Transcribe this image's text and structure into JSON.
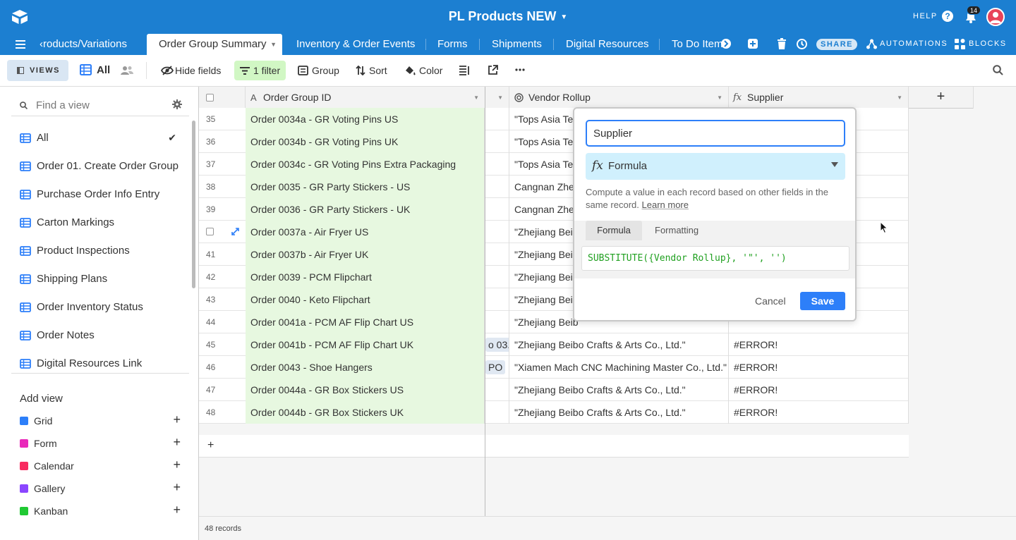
{
  "topbar": {
    "base_title": "PL Products NEW",
    "help_label": "HELP",
    "help_icon_glyph": "?",
    "notification_count": "14",
    "accent_color": "#1c7fd1"
  },
  "tabs": [
    {
      "label": "‹roducts/Variations"
    },
    {
      "label": "Order Group Summary",
      "active": true
    },
    {
      "label": "Inventory & Order Events"
    },
    {
      "label": "Forms"
    },
    {
      "label": "Shipments"
    },
    {
      "label": "Digital Resources"
    },
    {
      "label": "To Do Item"
    }
  ],
  "tab_tools": {
    "share_label": "SHARE",
    "automations_label": "AUTOMATIONS",
    "blocks_label": "BLOCKS"
  },
  "viewbar": {
    "views_label": "VIEWS",
    "current_view": "All",
    "hide_fields": "Hide fields",
    "filter": "1 filter",
    "group": "Group",
    "sort": "Sort",
    "color": "Color"
  },
  "sidebar": {
    "find_placeholder": "Find a view",
    "views": [
      {
        "label": "All",
        "selected": true
      },
      {
        "label": "Order 01. Create Order Group"
      },
      {
        "label": "Purchase Order Info Entry"
      },
      {
        "label": "Carton Markings"
      },
      {
        "label": "Product Inspections"
      },
      {
        "label": "Shipping Plans"
      },
      {
        "label": "Order Inventory Status"
      },
      {
        "label": "Order Notes"
      },
      {
        "label": "Digital Resources Link"
      }
    ],
    "add_view_title": "Add view",
    "add_items": [
      {
        "label": "Grid",
        "color": "#2d7ff9"
      },
      {
        "label": "Form",
        "color": "#e929ba"
      },
      {
        "label": "Calendar",
        "color": "#f82b60"
      },
      {
        "label": "Gallery",
        "color": "#8b46ff"
      },
      {
        "label": "Kanban",
        "color": "#20c933"
      }
    ]
  },
  "grid": {
    "headers": {
      "primary": "Order Group ID",
      "vendor": "Vendor Rollup",
      "supplier": "Supplier"
    },
    "rows": [
      {
        "num": "35",
        "id": "Order 0034a - GR Voting Pins US",
        "gap": "",
        "vendor": "\"Tops Asia Te",
        "supplier": ""
      },
      {
        "num": "36",
        "id": "Order 0034b - GR Voting Pins UK",
        "gap": "",
        "vendor": "\"Tops Asia Te",
        "supplier": ""
      },
      {
        "num": "37",
        "id": "Order 0034c - GR Voting Pins Extra Packaging",
        "gap": "",
        "vendor": "\"Tops Asia Te",
        "supplier": ""
      },
      {
        "num": "38",
        "id": "Order 0035 - GR Party Stickers - US",
        "gap": "",
        "vendor": "Cangnan Zher",
        "supplier": ""
      },
      {
        "num": "39",
        "id": "Order 0036 - GR Party Stickers - UK",
        "gap": "",
        "vendor": "Cangnan Zher",
        "supplier": ""
      },
      {
        "num": "",
        "id": "Order 0037a - Air Fryer US",
        "gap": "",
        "vendor": "\"Zhejiang Beib",
        "supplier": "",
        "hover": true
      },
      {
        "num": "41",
        "id": "Order 0037b - Air Fryer UK",
        "gap": "",
        "vendor": "\"Zhejiang Beib",
        "supplier": ""
      },
      {
        "num": "42",
        "id": "Order 0039 - PCM Flipchart",
        "gap": "",
        "vendor": "\"Zhejiang Beib",
        "supplier": ""
      },
      {
        "num": "43",
        "id": "Order 0040 - Keto Flipchart",
        "gap": "",
        "vendor": "\"Zhejiang Beib",
        "supplier": ""
      },
      {
        "num": "44",
        "id": "Order 0041a - PCM AF Flip Chart US",
        "gap": "",
        "vendor": "\"Zhejiang Beib",
        "supplier": ""
      },
      {
        "num": "45",
        "id": "Order 0041b - PCM AF Flip Chart UK",
        "gap": "o 03.",
        "vendor": "\"Zhejiang Beibo Crafts & Arts Co., Ltd.\"",
        "supplier": "#ERROR!"
      },
      {
        "num": "46",
        "id": "Order 0043 - Shoe Hangers",
        "gap": "PO",
        "vendor": "\"Xiamen Mach CNC Machining Master Co., Ltd.\"",
        "supplier": "#ERROR!"
      },
      {
        "num": "47",
        "id": "Order 0044a - GR Box Stickers US",
        "gap": "",
        "vendor": "\"Zhejiang Beibo Crafts & Arts Co., Ltd.\"",
        "supplier": "#ERROR!"
      },
      {
        "num": "48",
        "id": "Order 0044b - GR Box Stickers UK",
        "gap": "",
        "vendor": "\"Zhejiang Beibo Crafts & Arts Co., Ltd.\"",
        "supplier": "#ERROR!"
      }
    ],
    "add_row_glyph": "+",
    "record_count": "48 records"
  },
  "popover": {
    "field_name": "Supplier",
    "field_type": "Formula",
    "description": "Compute a value in each record based on other fields in the same record.",
    "learn_more": "Learn more",
    "tab_formula": "Formula",
    "tab_formatting": "Formatting",
    "formula": "SUBSTITUTE({Vendor Rollup}, '\"', '')",
    "cancel": "Cancel",
    "save": "Save"
  }
}
